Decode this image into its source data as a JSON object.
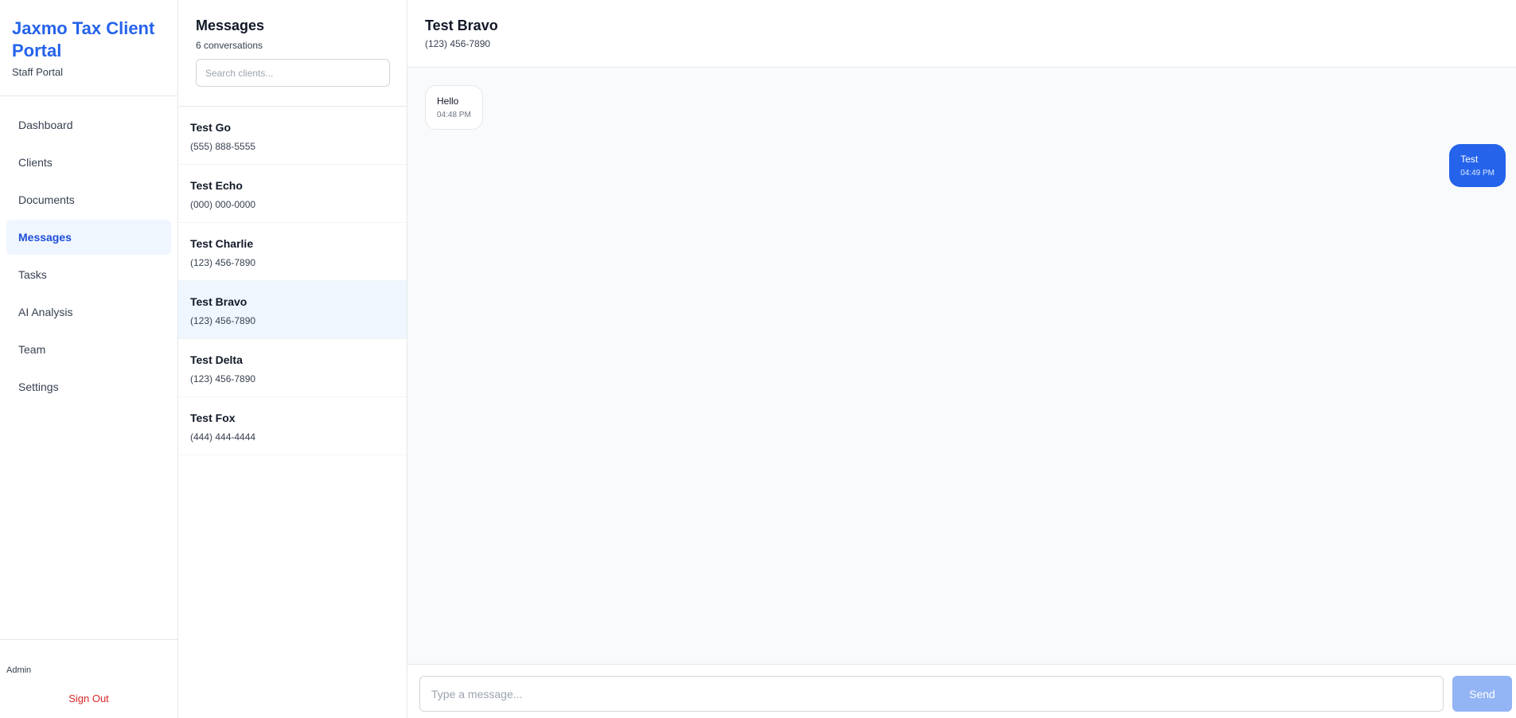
{
  "brand": {
    "title": "Jaxmo Tax Client Portal",
    "subtitle": "Staff Portal"
  },
  "nav": {
    "items": [
      {
        "label": "Dashboard"
      },
      {
        "label": "Clients"
      },
      {
        "label": "Documents"
      },
      {
        "label": "Messages",
        "active": true
      },
      {
        "label": "Tasks"
      },
      {
        "label": "AI Analysis"
      },
      {
        "label": "Team"
      },
      {
        "label": "Settings"
      }
    ]
  },
  "footer": {
    "user_role": "Admin",
    "signout_label": "Sign Out"
  },
  "conversations": {
    "title": "Messages",
    "count_text": "6 conversations",
    "search_placeholder": "Search clients...",
    "items": [
      {
        "name": "Test Go",
        "phone": "(555) 888-5555"
      },
      {
        "name": "Test Echo",
        "phone": "(000) 000-0000"
      },
      {
        "name": "Test Charlie",
        "phone": "(123) 456-7890"
      },
      {
        "name": "Test Bravo",
        "phone": "(123) 456-7890",
        "active": true
      },
      {
        "name": "Test Delta",
        "phone": "(123) 456-7890"
      },
      {
        "name": "Test Fox",
        "phone": "(444) 444-4444"
      }
    ]
  },
  "chat": {
    "contact_name": "Test Bravo",
    "contact_phone": "(123) 456-7890",
    "messages": [
      {
        "text": "Hello",
        "time": "04:48 PM",
        "direction": "in"
      },
      {
        "text": "Test",
        "time": "04:49 PM",
        "direction": "out"
      }
    ],
    "input_placeholder": "Type a message...",
    "send_label": "Send"
  },
  "colors": {
    "accent": "#2563eb",
    "active_bg": "#eff6ff",
    "danger": "#dc2626",
    "send_disabled": "#93b4f5"
  }
}
